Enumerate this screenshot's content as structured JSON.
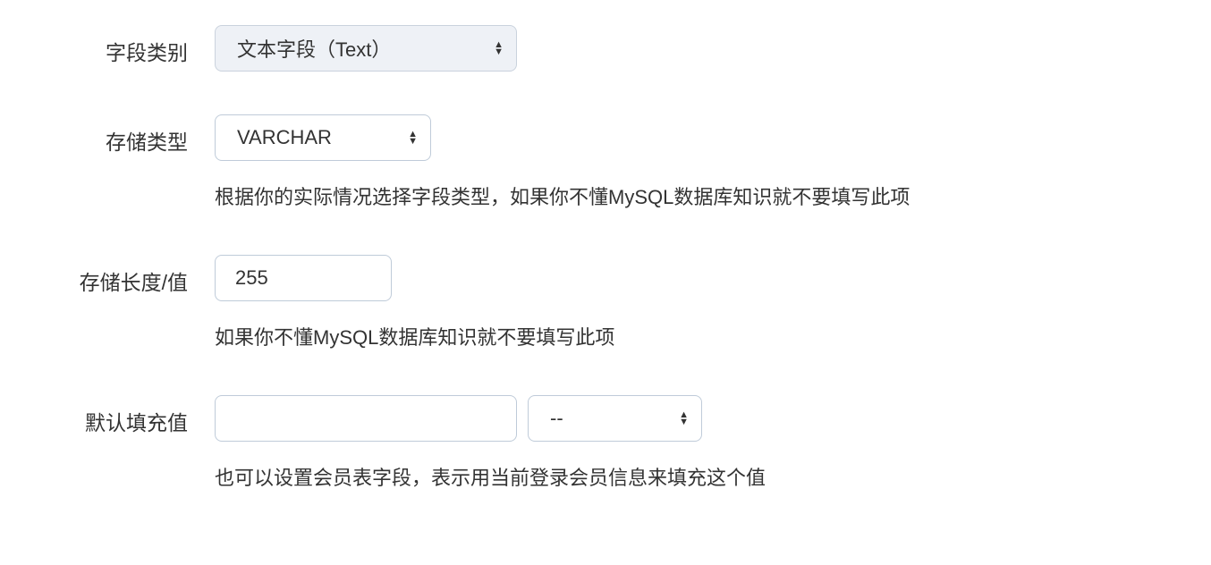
{
  "fields": {
    "field_category": {
      "label": "字段类别",
      "value": "文本字段（Text）"
    },
    "storage_type": {
      "label": "存储类型",
      "value": "VARCHAR",
      "help": "根据你的实际情况选择字段类型，如果你不懂MySQL数据库知识就不要填写此项"
    },
    "storage_length": {
      "label": "存储长度/值",
      "value": "255",
      "help": "如果你不懂MySQL数据库知识就不要填写此项"
    },
    "default_value": {
      "label": "默认填充值",
      "value": "",
      "select_value": "--",
      "help": "也可以设置会员表字段，表示用当前登录会员信息来填充这个值"
    }
  }
}
